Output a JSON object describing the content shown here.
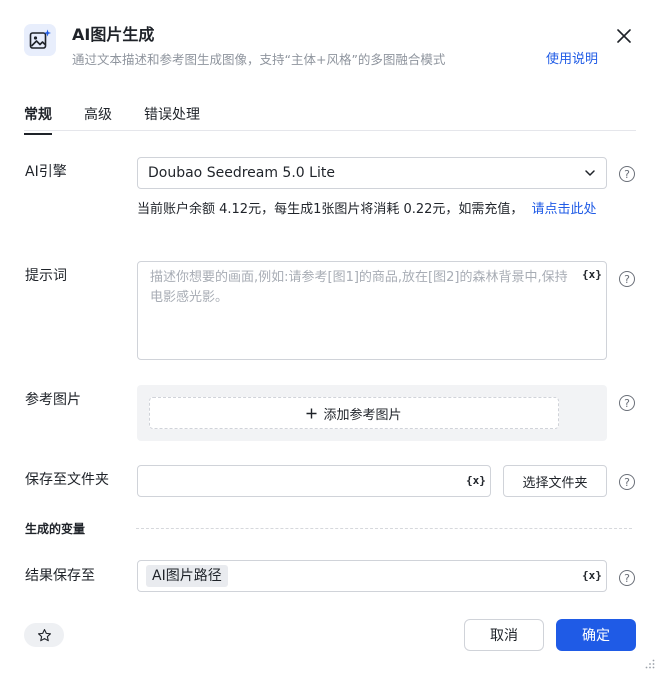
{
  "header": {
    "title": "AI图片生成",
    "subtitle": "通过文本描述和参考图生成图像，支持“主体+风格”的多图融合模式",
    "help_link": "使用说明",
    "icon": "image-sparkle-icon"
  },
  "tabs": [
    {
      "label": "常规",
      "active": true
    },
    {
      "label": "高级",
      "active": false
    },
    {
      "label": "错误处理",
      "active": false
    }
  ],
  "engine": {
    "label": "AI引擎",
    "value": "Doubao Seedream 5.0 Lite"
  },
  "balance": {
    "text": "当前账户余额 4.12元，每生成1张图片将消耗 0.22元，如需充值，",
    "link": "请点击此处"
  },
  "prompt": {
    "label": "提示词",
    "placeholder": "描述你想要的画面,例如:请参考[图1]的商品,放在[图2]的森林背景中,保持电影感光影。",
    "var_label": "{x}"
  },
  "reference": {
    "label": "参考图片",
    "add_label": "添加参考图片"
  },
  "folder": {
    "label": "保存至文件夹",
    "value": "",
    "var_label": "{x}",
    "choose_label": "选择文件夹"
  },
  "variables": {
    "section_title": "生成的变量",
    "result_label": "结果保存至",
    "result_tag": "AI图片路径",
    "var_label": "{x}"
  },
  "footer": {
    "cancel_label": "取消",
    "confirm_label": "确定"
  },
  "help_glyph": "?",
  "colors": {
    "accent": "#1f5be6",
    "text": "#1f2329",
    "muted": "#8f959e",
    "border": "#d0d3d9"
  }
}
